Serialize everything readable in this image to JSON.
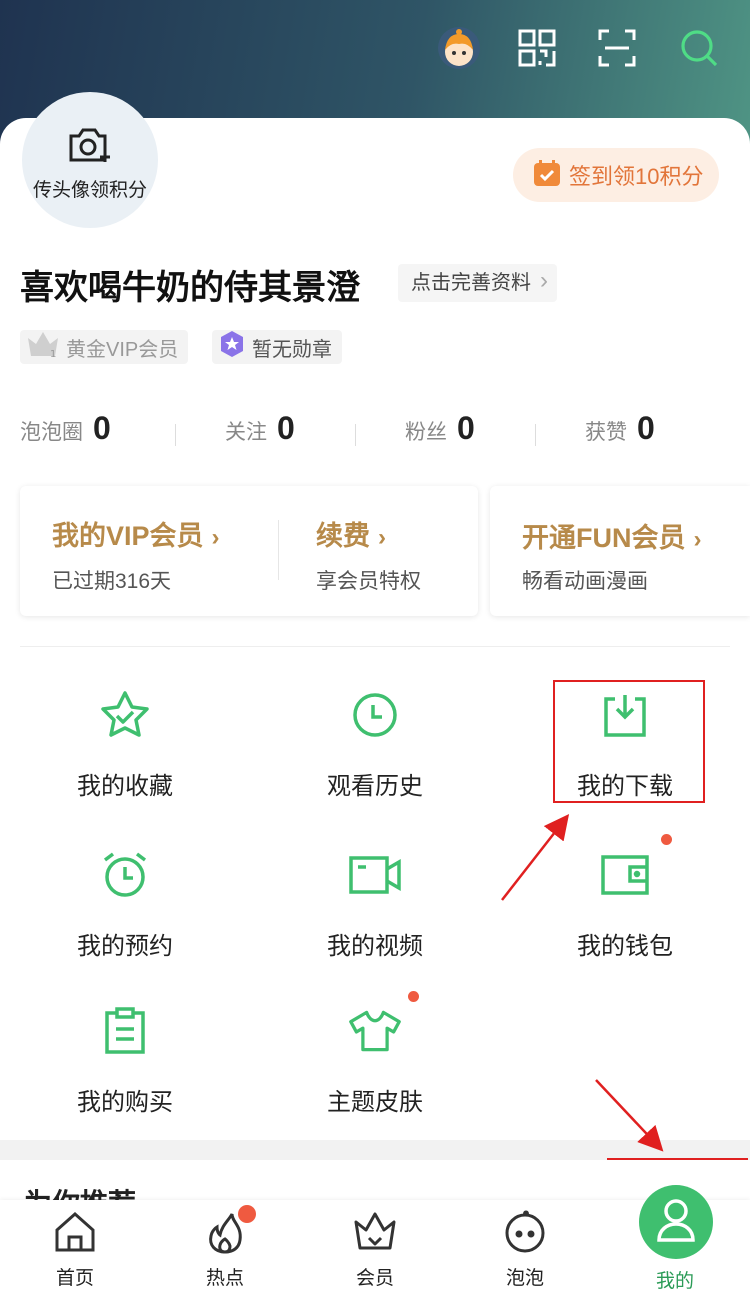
{
  "header": {
    "icons": [
      "avatar-character-icon",
      "qr-code-icon",
      "scan-icon",
      "search-icon"
    ]
  },
  "profile": {
    "upload_avatar_label": "传头像领积分",
    "checkin_label": "签到领10积分",
    "username": "喜欢喝牛奶的侍其景澄",
    "complete_profile_label": "点击完善资料",
    "tags": [
      {
        "label": "黄金VIP会员",
        "icon": "crown-icon"
      },
      {
        "label": "暂无勋章",
        "icon": "medal-star-icon"
      }
    ]
  },
  "stats": [
    {
      "label": "泡泡圈",
      "value": "0"
    },
    {
      "label": "关注",
      "value": "0"
    },
    {
      "label": "粉丝",
      "value": "0"
    },
    {
      "label": "获赞",
      "value": "0"
    }
  ],
  "vip": {
    "my_vip": {
      "title": "我的VIP会员",
      "subtitle": "已过期316天"
    },
    "renew": {
      "title": "续费",
      "subtitle": "享会员特权"
    },
    "fun": {
      "title": "开通FUN会员",
      "subtitle": "畅看动画漫画"
    },
    "chevron": "›"
  },
  "menu": [
    {
      "label": "我的收藏",
      "icon": "star-icon"
    },
    {
      "label": "观看历史",
      "icon": "clock-icon"
    },
    {
      "label": "我的下载",
      "icon": "download-icon"
    },
    {
      "label": "我的预约",
      "icon": "alarm-clock-icon"
    },
    {
      "label": "我的视频",
      "icon": "video-camera-icon"
    },
    {
      "label": "我的钱包",
      "icon": "wallet-icon"
    },
    {
      "label": "我的购买",
      "icon": "clipboard-icon"
    },
    {
      "label": "主题皮肤",
      "icon": "tshirt-icon"
    }
  ],
  "recommend": {
    "title": "为你推荐"
  },
  "tabbar": [
    {
      "label": "首页",
      "icon": "home-icon"
    },
    {
      "label": "热点",
      "icon": "flame-icon"
    },
    {
      "label": "会员",
      "icon": "crown-icon"
    },
    {
      "label": "泡泡",
      "icon": "bubble-face-icon"
    },
    {
      "label": "我的",
      "icon": "person-icon"
    }
  ],
  "colors": {
    "accent_green": "#3fbf6f",
    "gold": "#b78a4a",
    "checkin_orange": "#e2753a",
    "badge_red": "#ef5a40",
    "highlight_red": "#e02020"
  }
}
